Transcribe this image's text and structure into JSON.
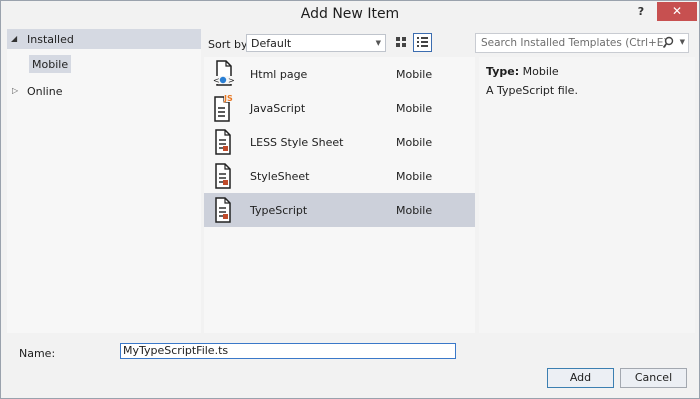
{
  "window": {
    "title": "Add New Item",
    "help_glyph": "?",
    "close_glyph": "✕"
  },
  "tree": {
    "installed": {
      "label": "Installed",
      "arrow": "◢"
    },
    "mobile": {
      "label": "Mobile"
    },
    "online": {
      "label": "Online",
      "arrow": "▷"
    }
  },
  "toolbar": {
    "sort_label": "Sort by:",
    "sort_value": "Default",
    "dropdown_glyph": "▼",
    "search_placeholder": "Search Installed Templates (Ctrl+E)"
  },
  "items": [
    {
      "name": "Html page",
      "category": "Mobile",
      "icon": "html-page-icon",
      "selected": false
    },
    {
      "name": "JavaScript",
      "category": "Mobile",
      "icon": "javascript-file-icon",
      "selected": false
    },
    {
      "name": "LESS Style Sheet",
      "category": "Mobile",
      "icon": "less-stylesheet-icon",
      "selected": false
    },
    {
      "name": "StyleSheet",
      "category": "Mobile",
      "icon": "stylesheet-icon",
      "selected": false
    },
    {
      "name": "TypeScript",
      "category": "Mobile",
      "icon": "typescript-file-icon",
      "selected": true
    }
  ],
  "details": {
    "type_label": "Type:",
    "type_value": "Mobile",
    "description": "A TypeScript file."
  },
  "form": {
    "name_label": "Name:",
    "name_value": "MyTypeScriptFile.ts",
    "add_label": "Add",
    "cancel_label": "Cancel"
  },
  "colors": {
    "selection": "#ccd0da",
    "close_button": "#c75050",
    "focus_border": "#3a78c9",
    "js_badge": "#e87722",
    "html_globe": "#2a7fd4"
  }
}
